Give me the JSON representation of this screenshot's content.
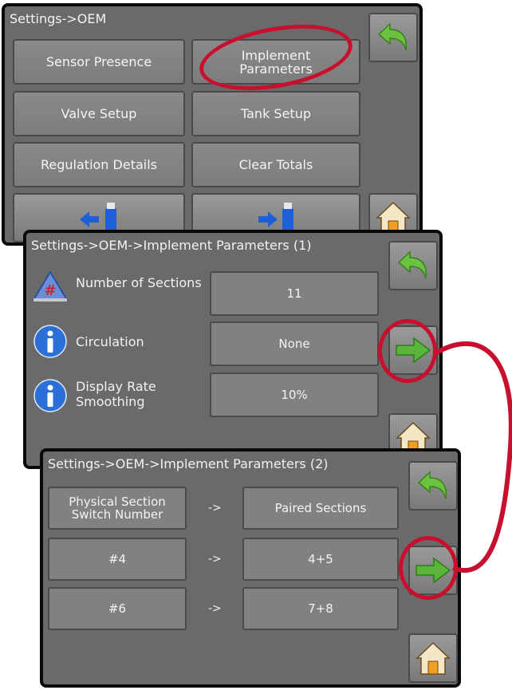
{
  "screen1": {
    "title": "Settings->OEM",
    "buttons": {
      "sensor_presence": "Sensor Presence",
      "implement_parameters": "Implement Parameters",
      "valve_setup": "Valve Setup",
      "tank_setup": "Tank Setup",
      "regulation_details": "Regulation Details",
      "clear_totals": "Clear Totals"
    },
    "icons": [
      "back-arrow-icon",
      "usb-import-icon",
      "usb-export-icon",
      "home-icon"
    ]
  },
  "screen2": {
    "title": "Settings->OEM->Implement Parameters (1)",
    "rows": [
      {
        "label": "Number of Sections",
        "value": "11",
        "icon": "sections-icon"
      },
      {
        "label": "Circulation",
        "value": "None",
        "icon": "info-icon"
      },
      {
        "label": "Display Rate Smoothing",
        "value": "10%",
        "icon": "info-icon"
      }
    ]
  },
  "screen3": {
    "title": "Settings->OEM->Implement Parameters (2)",
    "header": {
      "left": "Physical Section Switch Number",
      "arrow": "->",
      "right": "Paired Sections"
    },
    "rows": [
      {
        "left": "#4",
        "arrow": "->",
        "right": "4+5"
      },
      {
        "left": "#6",
        "arrow": "->",
        "right": "7+8"
      }
    ]
  },
  "colors": {
    "screen_bg": "#6a6a6a",
    "highlight": "#c8102e",
    "arrow_green": "#5ab53a"
  }
}
